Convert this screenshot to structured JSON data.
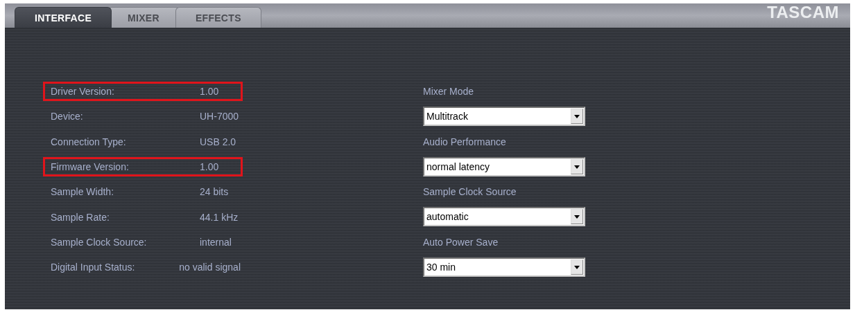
{
  "tabs": [
    {
      "label": "INTERFACE",
      "selected": true
    },
    {
      "label": "MIXER",
      "selected": false
    },
    {
      "label": "EFFECTS",
      "selected": false
    }
  ],
  "logo": "TASCAM",
  "info": [
    {
      "label": "Driver Version:",
      "value": "1.00",
      "highlighted": true
    },
    {
      "label": "Device:",
      "value": "UH-7000",
      "highlighted": false
    },
    {
      "label": "Connection Type:",
      "value": "USB 2.0",
      "highlighted": false
    },
    {
      "label": "Firmware Version:",
      "value": "1.00",
      "highlighted": true
    },
    {
      "label": "Sample Width:",
      "value": "24 bits",
      "highlighted": false
    },
    {
      "label": "Sample Rate:",
      "value": "44.1 kHz",
      "highlighted": false
    },
    {
      "label": "Sample Clock Source:",
      "value": "internal",
      "highlighted": false
    },
    {
      "label": "Digital Input Status:",
      "value": "no valid signal",
      "highlighted": false
    }
  ],
  "settings": [
    {
      "label": "Mixer Mode",
      "value": "Multitrack"
    },
    {
      "label": "Audio Performance",
      "value": "normal latency"
    },
    {
      "label": "Sample Clock Source",
      "value": "automatic"
    },
    {
      "label": "Auto Power Save",
      "value": "30 min"
    }
  ]
}
